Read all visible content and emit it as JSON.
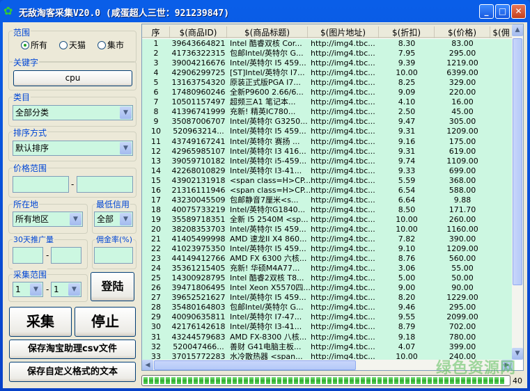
{
  "window": {
    "title": "无敌淘客采集V20.0 (咸蛋超人三世：921239847)",
    "minimize": "_",
    "maximize": "□",
    "close": "✕"
  },
  "left": {
    "scope": {
      "label": "范围",
      "options": [
        "所有",
        "天猫",
        "集市"
      ],
      "selected": 0
    },
    "keyword": {
      "label": "关键字",
      "value": "cpu"
    },
    "category": {
      "label": "类目",
      "value": "全部分类"
    },
    "sort": {
      "label": "排序方式",
      "value": "默认排序"
    },
    "price": {
      "label": "价格范围",
      "min": "",
      "max": "",
      "sep": "-"
    },
    "location": {
      "label": "所在地",
      "value": "所有地区"
    },
    "credit": {
      "label": "最低信用",
      "value": "全部"
    },
    "promo": {
      "label": "30天推广量",
      "min": "",
      "max": "",
      "sep": "-"
    },
    "commission": {
      "label": "佣金率(%)",
      "value": ""
    },
    "range": {
      "label": "采集范围",
      "from": "1",
      "to": "1",
      "sep": "-"
    },
    "login": "登陆",
    "collect": "采集",
    "stop": "停止",
    "save_csv": "保存淘宝助理csv文件",
    "save_custom": "保存自定义格式的文本"
  },
  "table": {
    "columns": [
      "序",
      "$(商品ID)",
      "$(商品标题)",
      "$(图片地址)",
      "$(折扣)",
      "$(价格)",
      "$(佣"
    ],
    "rows": [
      [
        "1",
        "39643664821",
        "Intel 酷睿双核 Cor...",
        "http://img4.tbc...",
        "8.30",
        "83.00"
      ],
      [
        "2",
        "41736322315",
        "包邮Intel/英特尔 G...",
        "http://img4.tbc...",
        "7.95",
        "295.00"
      ],
      [
        "3",
        "39004216676",
        "Intel/英特尔 I5 459...",
        "http://img4.tbc...",
        "9.39",
        "1219.00"
      ],
      [
        "4",
        "42906299725",
        "[ST]Intel/英特尔 I7...",
        "http://img4.tbc...",
        "10.00",
        "6399.00"
      ],
      [
        "5",
        "13163754320",
        "原装正式版PGA I7...",
        "http://img4.tbc...",
        "8.25",
        "329.00"
      ],
      [
        "6",
        "17480960246",
        "全新P9600 2.66/6...",
        "http://img4.tbc...",
        "9.09",
        "220.00"
      ],
      [
        "7",
        "10501157497",
        "超频三A1 笔记本...",
        "http://img4.tbc...",
        "4.10",
        "16.00"
      ],
      [
        "8",
        "41396741999",
        "充新! 精英IC780...",
        "http://img4.tbc...",
        "2.50",
        "45.00"
      ],
      [
        "9",
        "35087006707",
        "Intel/英特尔 G3250...",
        "http://img4.tbc...",
        "9.47",
        "305.00"
      ],
      [
        "10",
        "520963214...",
        "Intel/英特尔 I5 459...",
        "http://img4.tbc...",
        "9.31",
        "1209.00"
      ],
      [
        "11",
        "43749167241",
        "Intel/英特尔 赛扬 ...",
        "http://img4.tbc...",
        "9.16",
        "175.00"
      ],
      [
        "12",
        "42965985107",
        "Intel/英特尔 I3 416...",
        "http://img4.tbc...",
        "9.31",
        "619.00"
      ],
      [
        "13",
        "39059710182",
        "Intel/英特尔 i5-459...",
        "http://img4.tbc...",
        "9.74",
        "1109.00"
      ],
      [
        "14",
        "42268010829",
        "Intel/英特尔 I3-41...",
        "http://img4.tbc...",
        "9.33",
        "699.00"
      ],
      [
        "15",
        "43902131918",
        "<span class=H>CP...",
        "http://img4.tbc...",
        "5.59",
        "368.00"
      ],
      [
        "16",
        "21316111946",
        "<span class=H>CP...",
        "http://img4.tbc...",
        "6.54",
        "588.00"
      ],
      [
        "17",
        "43230045509",
        "包邮静音7厘米<s...",
        "http://img4.tbc...",
        "6.64",
        "9.88"
      ],
      [
        "18",
        "40075733219",
        "Intel/英特尔G1840...",
        "http://img4.tbc...",
        "8.50",
        "171.70"
      ],
      [
        "19",
        "35589718351",
        "全新 I5 2540M <sp...",
        "http://img4.tbc...",
        "10.00",
        "260.00"
      ],
      [
        "20",
        "38208353703",
        "Intel/英特尔 I5 459...",
        "http://img4.tbc...",
        "10.00",
        "1160.00"
      ],
      [
        "21",
        "41405499998",
        "AMD 速龙II X4 860...",
        "http://img4.tbc...",
        "7.82",
        "390.00"
      ],
      [
        "22",
        "41023975350",
        "Intel/英特尔 I5 459...",
        "http://img4.tbc...",
        "9.10",
        "1209.00"
      ],
      [
        "23",
        "44149412766",
        "AMD FX 6300 六核...",
        "http://img4.tbc...",
        "8.76",
        "560.00"
      ],
      [
        "24",
        "35361215405",
        "充新! 华硕M4A77...",
        "http://img4.tbc...",
        "3.06",
        "55.00"
      ],
      [
        "25",
        "14300928795",
        "Intel 酷睿2双核 T8...",
        "http://img4.tbc...",
        "5.00",
        "50.00"
      ],
      [
        "26",
        "39471806495",
        "Intel Xeon X5570四...",
        "http://img4.tbc...",
        "9.00",
        "90.00"
      ],
      [
        "27",
        "39652521627",
        "Intel/英特尔 I5 459...",
        "http://img4.tbc...",
        "8.20",
        "1229.00"
      ],
      [
        "28",
        "35480164803",
        "包邮Intel/英特尔 G...",
        "http://img4.tbc...",
        "9.46",
        "295.00"
      ],
      [
        "29",
        "40090635811",
        "Intel/英特尔 I7-47...",
        "http://img4.tbc...",
        "9.55",
        "2099.00"
      ],
      [
        "30",
        "42176142618",
        "Intel/英特尔 I3-41...",
        "http://img4.tbc...",
        "8.79",
        "702.00"
      ],
      [
        "31",
        "43244579683",
        "AMD FX-8300 八核...",
        "http://img4.tbc...",
        "9.18",
        "780.00"
      ],
      [
        "32",
        "520047466...",
        "善财 G41电脑主板...",
        "http://img4.tbc...",
        "4.07",
        "399.00"
      ],
      [
        "33",
        "37015772283",
        "水冷散热器 <span...",
        "http://img4.tbc...",
        "10.00",
        "240.00"
      ]
    ]
  },
  "progress": {
    "percent": 100,
    "count": "40"
  },
  "watermark": "绿色资源网",
  "colors": {
    "grid_bg": "#ccf7e1",
    "titlebar": "#0a5ee8",
    "progress": "#2eaf2e"
  }
}
